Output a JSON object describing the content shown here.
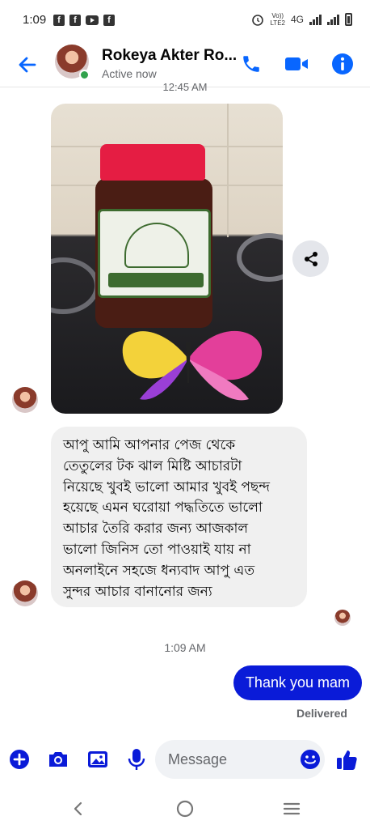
{
  "status_bar": {
    "time": "1:09",
    "left_icons": [
      "facebook-icon",
      "facebook-icon",
      "youtube-icon",
      "facebook-icon"
    ],
    "network_label": "4G",
    "volte_label": "Vo))\nLTE2"
  },
  "header": {
    "contact_name": "Rokeya Akter Ro...",
    "status": "Active now",
    "accent_color": "#0866ff",
    "online_color": "#31a24c"
  },
  "chat": {
    "partial_timestamp": "12:45 AM",
    "image_alt": "Jar of tamarind pickle",
    "incoming_message": "আপু আমি আপনার পেজ থেকে তেতুলের টক ঝাল মিষ্টি আচারটা নিয়েছে খুবই ভালো আমার খুবই পছন্দ হয়েছে এমন ঘরোয়া পদ্ধতিতে ভালো আচার তৈরি করার জন্য আজকাল ভালো জিনিস তো পাওয়াই যায় না অনলাইনে সহজে ধন্যবাদ আপু এত সুন্দর আচার বানানোর জন্য",
    "incoming_lines": [
      "আপু আমি আপনার পেজ থেকে",
      "তেতুলের টক ঝাল মিষ্টি আচারটা",
      "নিয়েছে খুবই ভালো আমার খুবই পছন্দ",
      "হয়েছে এমন ঘরোয়া পদ্ধতিতে ভালো",
      "আচার তৈরি করার জন্য আজকাল",
      "ভালো জিনিস তো পাওয়াই যায় না",
      "অনলাইনে সহজে ধন্যবাদ আপু এত",
      "সুন্দর আচার বানানোর জন্য"
    ],
    "time_divider": "1:09 AM",
    "outgoing_message": "Thank you mam",
    "outgoing_color": "#0a1bd8",
    "delivery_status": "Delivered"
  },
  "composer": {
    "placeholder": "Message",
    "value": ""
  },
  "navbar": {
    "buttons": [
      "back-icon",
      "home-icon",
      "recents-icon"
    ]
  }
}
